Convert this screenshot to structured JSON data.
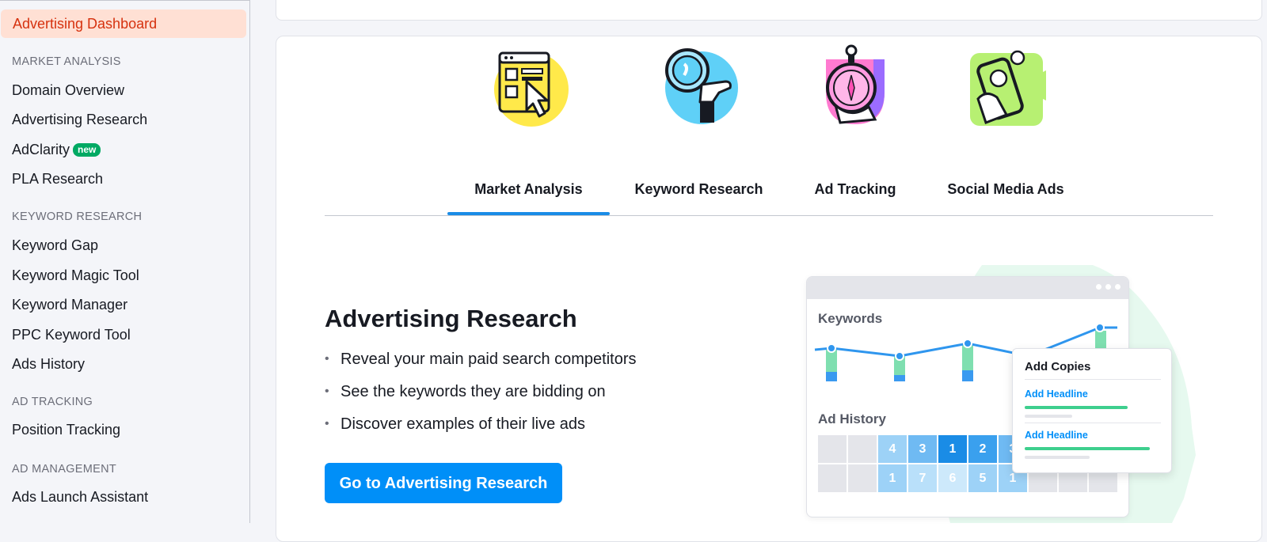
{
  "sidebar": {
    "active_item": "Advertising Dashboard",
    "sections": [
      {
        "title": "MARKET ANALYSIS",
        "items": [
          "Domain Overview",
          "Advertising Research",
          "AdClarity",
          "PLA Research"
        ]
      },
      {
        "title": "KEYWORD RESEARCH",
        "items": [
          "Keyword Gap",
          "Keyword Magic Tool",
          "Keyword Manager",
          "PPC Keyword Tool",
          "Ads History"
        ]
      },
      {
        "title": "AD TRACKING",
        "items": [
          "Position Tracking"
        ]
      },
      {
        "title": "AD MANAGEMENT",
        "items": [
          "Ads Launch Assistant"
        ]
      }
    ],
    "new_badge": "new"
  },
  "tabs": [
    {
      "label": "Market Analysis",
      "icon": "browser-cursor-icon",
      "selected": true
    },
    {
      "label": "Keyword Research",
      "icon": "magnifier-hand-icon",
      "selected": false
    },
    {
      "label": "Ad Tracking",
      "icon": "stopwatch-hand-icon",
      "selected": false
    },
    {
      "label": "Social Media Ads",
      "icon": "phone-hand-icon",
      "selected": false
    }
  ],
  "feature": {
    "title": "Advertising Research",
    "bullets": [
      "Reveal your main paid search competitors",
      "See the keywords they are bidding on",
      "Discover examples of their live ads"
    ],
    "cta_label": "Go to Advertising Research"
  },
  "illustration": {
    "keywords_label": "Keywords",
    "ad_history_label": "Ad History",
    "grid_row1": [
      "",
      "",
      "4",
      "3",
      "1",
      "2",
      "3",
      "",
      "",
      ""
    ],
    "grid_row2": [
      "",
      "",
      "1",
      "7",
      "6",
      "5",
      "1",
      "",
      "",
      ""
    ],
    "popup": {
      "title": "Add Copies",
      "link1": "Add Headline",
      "link2": "Add Headline"
    }
  },
  "colors": {
    "accent": "#008ff8",
    "active_bg": "#ffe0d4",
    "active_text": "#d6320f",
    "tab_indicator": "#1a8ce6",
    "badge": "#00a963"
  }
}
